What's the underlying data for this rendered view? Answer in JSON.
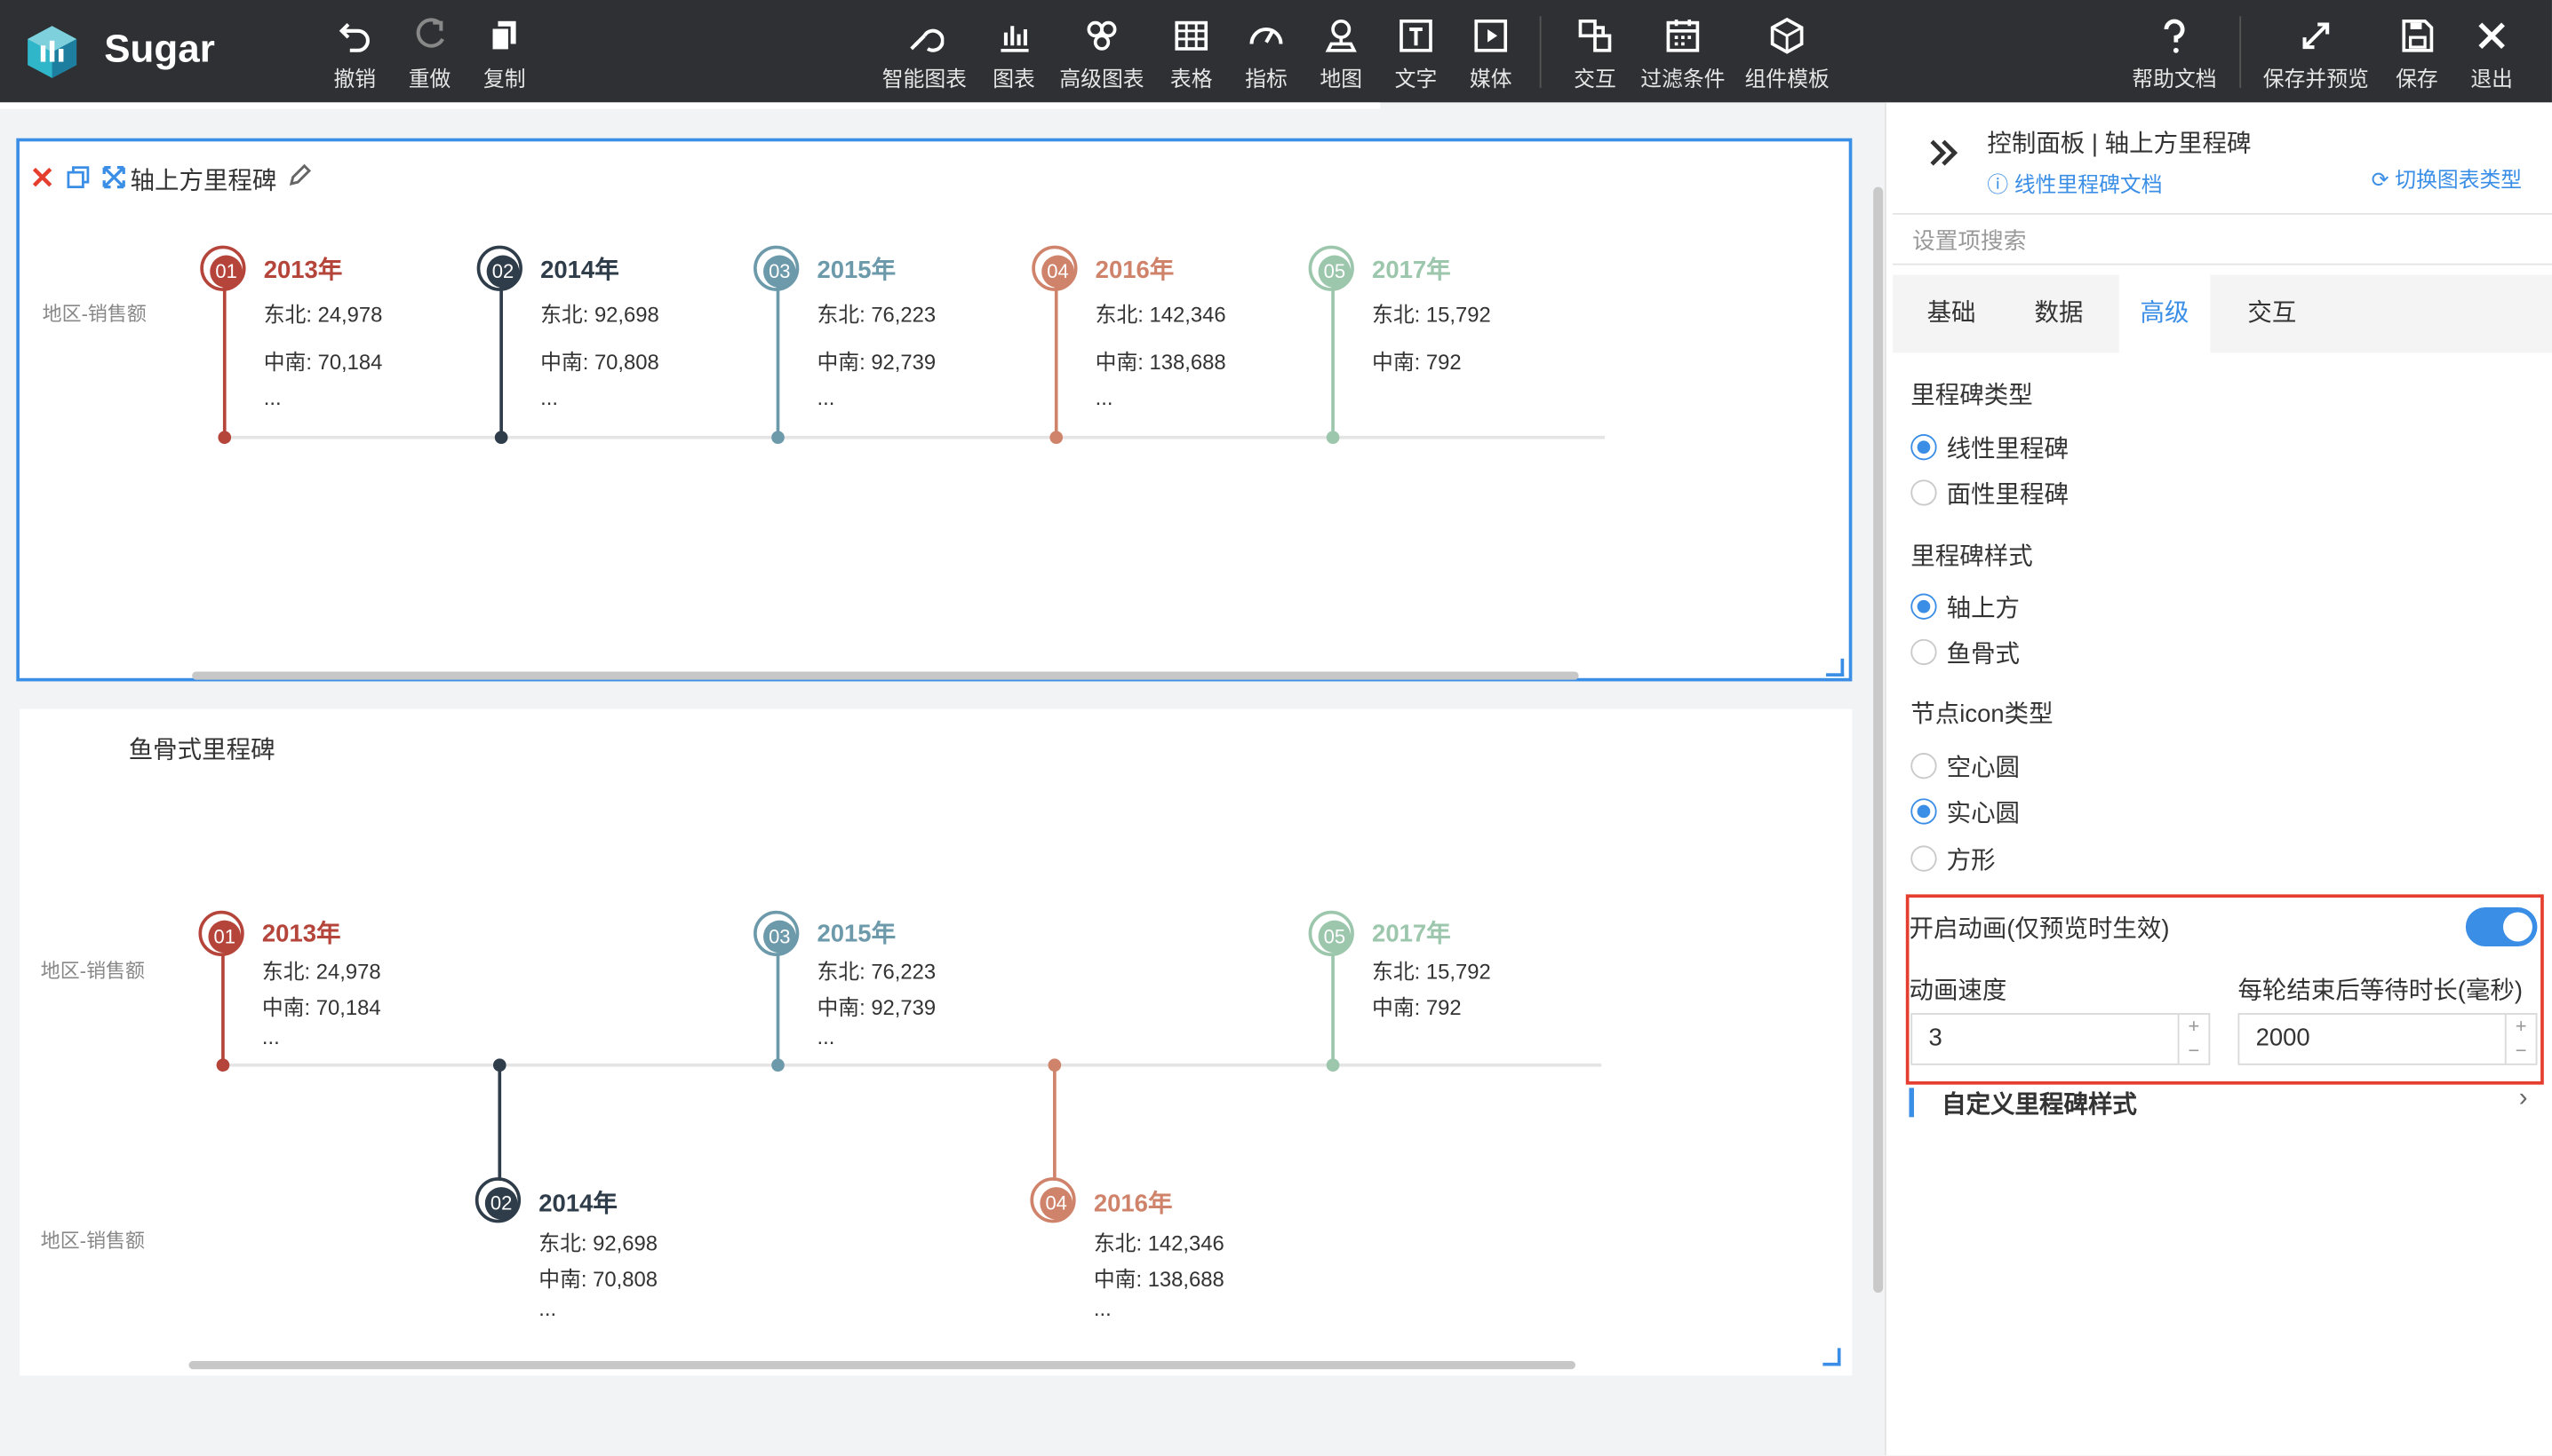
{
  "app": {
    "name": "Sugar"
  },
  "toolbar": {
    "undo": "撤销",
    "redo": "重做",
    "copy": "复制",
    "smart_chart": "智能图表",
    "chart": "图表",
    "advanced_chart": "高级图表",
    "table": "表格",
    "indicator": "指标",
    "map": "地图",
    "text": "文字",
    "media": "媒体",
    "interaction": "交互",
    "filter": "过滤条件",
    "component_template": "组件模板",
    "help": "帮助文档",
    "save_preview": "保存并预览",
    "save": "保存",
    "exit": "退出"
  },
  "chart1": {
    "title": "轴上方里程碑",
    "row_label": "地区-销售额",
    "items": [
      {
        "num": "01",
        "year": "2013年",
        "color": "#b5453b",
        "line1": "东北: 24,978",
        "line2": "中南: 70,184",
        "more": "..."
      },
      {
        "num": "02",
        "year": "2014年",
        "color": "#2f3c4a",
        "line1": "东北: 92,698",
        "line2": "中南: 70,808",
        "more": "..."
      },
      {
        "num": "03",
        "year": "2015年",
        "color": "#6d9aab",
        "line1": "东北: 76,223",
        "line2": "中南: 92,739",
        "more": "..."
      },
      {
        "num": "04",
        "year": "2016年",
        "color": "#d0836b",
        "line1": "东北: 142,346",
        "line2": "中南: 138,688",
        "more": "..."
      },
      {
        "num": "05",
        "year": "2017年",
        "color": "#9cc7ad",
        "line1": "东北: 15,792",
        "line2": "中南: 792",
        "more": ""
      }
    ]
  },
  "chart2": {
    "title": "鱼骨式里程碑",
    "row_label_top": "地区-销售额",
    "row_label_bottom": "地区-销售额",
    "items": [
      {
        "num": "01",
        "year": "2013年",
        "color": "#b5453b",
        "line1": "东北: 24,978",
        "line2": "中南: 70,184",
        "more": "...",
        "side": "top"
      },
      {
        "num": "02",
        "year": "2014年",
        "color": "#2f3c4a",
        "line1": "东北: 92,698",
        "line2": "中南: 70,808",
        "more": "...",
        "side": "bottom"
      },
      {
        "num": "03",
        "year": "2015年",
        "color": "#6d9aab",
        "line1": "东北: 76,223",
        "line2": "中南: 92,739",
        "more": "...",
        "side": "top"
      },
      {
        "num": "04",
        "year": "2016年",
        "color": "#d0836b",
        "line1": "东北: 142,346",
        "line2": "中南: 138,688",
        "more": "...",
        "side": "bottom"
      },
      {
        "num": "05",
        "year": "2017年",
        "color": "#9cc7ad",
        "line1": "东北: 15,792",
        "line2": "中南: 792",
        "more": "",
        "side": "top"
      }
    ]
  },
  "panel": {
    "title": "控制面板 | 轴上方里程碑",
    "doc_link": "线性里程碑文档",
    "switch_link": "切换图表类型",
    "search_placeholder": "设置项搜索",
    "tabs": [
      "基础",
      "数据",
      "高级",
      "交互"
    ],
    "active_tab": "高级",
    "milestone_type_label": "里程碑类型",
    "milestone_type_options": [
      "线性里程碑",
      "面性里程碑"
    ],
    "milestone_style_label": "里程碑样式",
    "milestone_style_options": [
      "轴上方",
      "鱼骨式"
    ],
    "node_icon_label": "节点icon类型",
    "node_icon_options": [
      "空心圆",
      "实心圆",
      "方形"
    ],
    "animation_label": "开启动画(仅预览时生效)",
    "animation_on": true,
    "speed_label": "动画速度",
    "speed_value": "3",
    "wait_label": "每轮结束后等待时长(毫秒)",
    "wait_value": "2000",
    "custom_label": "自定义里程碑样式",
    "accent": "#3a8ee6",
    "highlight": "#e53e2e"
  }
}
